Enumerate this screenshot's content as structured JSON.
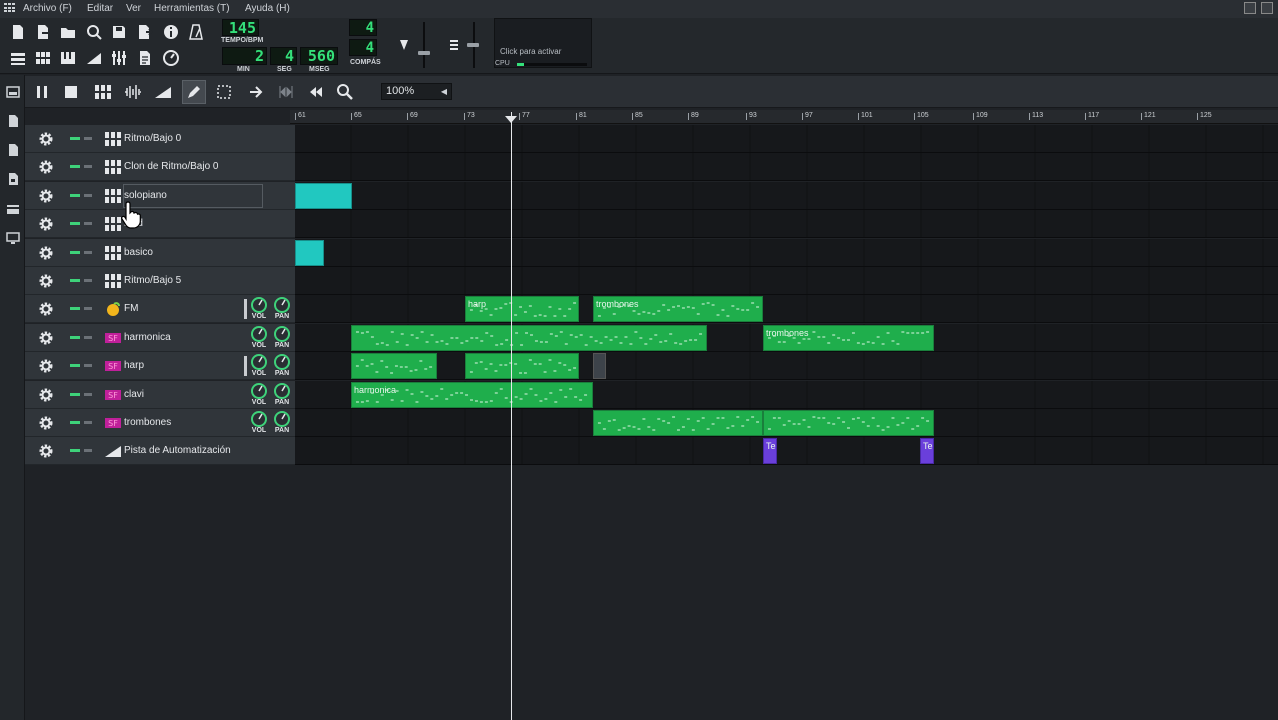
{
  "menu": {
    "items": [
      "Archivo (F)",
      "Editar",
      "Ver",
      "Herramientas (T)",
      "Ayuda (H)"
    ]
  },
  "transport": {
    "tempo": "145",
    "tempo_label": "TEMPO/BPM",
    "min": "2",
    "min_label": "MIN",
    "sec": "4",
    "sec_label": "SEG",
    "msec": "560",
    "msec_label": "MSEG",
    "time_sig_num": "4",
    "time_sig_den": "4",
    "time_sig_label": "COMPÁS",
    "click_to_activate": "Click para activar",
    "cpu_label": "CPU",
    "cpu_load": 0.1
  },
  "song_editor": {
    "zoom": "100%",
    "ruler_ticks": [
      "61",
      "65",
      "69",
      "73",
      "77",
      "81",
      "85",
      "89",
      "93",
      "97",
      "101",
      "105",
      "109",
      "113",
      "117",
      "121",
      "125"
    ]
  },
  "knobs": {
    "vol": "VOL",
    "pan": "PAN"
  },
  "tracks": [
    {
      "name": "Ritmo/Bajo 0",
      "type": "beat"
    },
    {
      "name": "Clon de Ritmo/Bajo 0",
      "type": "beat"
    },
    {
      "name": "solopiano",
      "type": "beat"
    },
    {
      "name": "land",
      "type": "beat"
    },
    {
      "name": "basico",
      "type": "beat"
    },
    {
      "name": "Ritmo/Bajo 5",
      "type": "beat"
    },
    {
      "name": "FM",
      "type": "instrument"
    },
    {
      "name": "harmonica",
      "type": "instrument"
    },
    {
      "name": "harp",
      "type": "instrument"
    },
    {
      "name": "clavi",
      "type": "instrument"
    },
    {
      "name": "trombones",
      "type": "instrument"
    },
    {
      "name": "Pista de Automatización",
      "type": "automation"
    }
  ],
  "clip_labels": {
    "fm_harp": "harp",
    "fm_trombones": "trombones",
    "harmonica_trombones": "trombones",
    "clavi_harmonica": "harmonica",
    "auto_1": "Te",
    "auto_2": "Te"
  },
  "colors": {
    "pattern_green": "#1fae4c",
    "pattern_cyan": "#21c8c0",
    "automation_purple": "#6a3fdb",
    "lcd_green": "#34e07a"
  }
}
